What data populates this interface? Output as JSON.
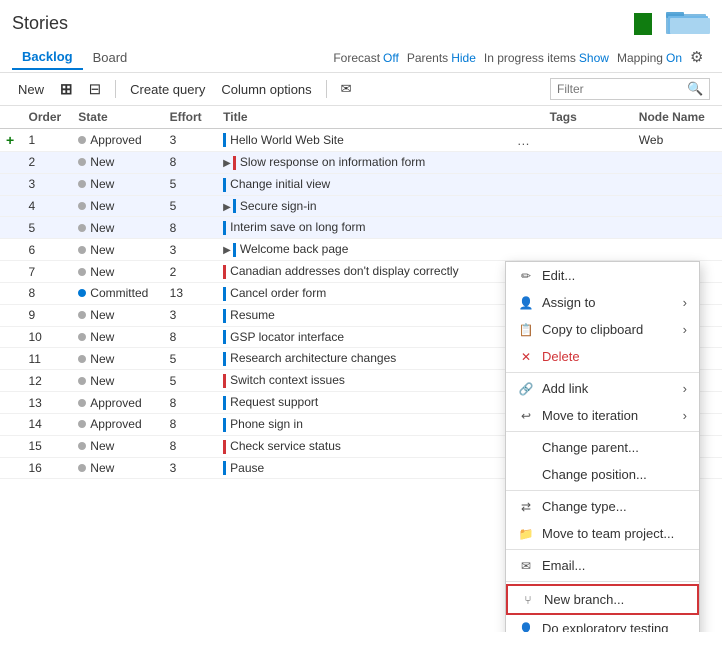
{
  "page": {
    "title": "Stories",
    "nav": {
      "backlog_label": "Backlog",
      "board_label": "Board",
      "forecast_label": "Forecast",
      "forecast_value": "Off",
      "parents_label": "Parents",
      "parents_value": "Hide",
      "inprogress_label": "In progress items",
      "inprogress_value": "Show",
      "mapping_label": "Mapping",
      "mapping_value": "On"
    },
    "toolbar": {
      "new_label": "New",
      "add_icon_label": "+",
      "expand_label": "⊟",
      "create_query_label": "Create query",
      "column_options_label": "Column options",
      "email_label": "✉",
      "filter_placeholder": "Filter"
    },
    "table": {
      "columns": [
        "",
        "Order",
        "State",
        "Effort",
        "Title",
        "",
        "Tags",
        "Node Name"
      ],
      "rows": [
        {
          "order": 1,
          "state": "Approved",
          "state_color": "grey",
          "effort": 3,
          "title": "Hello World Web Site",
          "bar_color": "blue",
          "tags": "",
          "node_name": "Web",
          "ellipsis": true
        },
        {
          "order": 2,
          "state": "New",
          "state_color": "grey",
          "effort": 8,
          "title": "Slow response on information form",
          "bar_color": "red",
          "tags": "",
          "node_name": "",
          "ellipsis": false,
          "expand": true,
          "highlighted": true
        },
        {
          "order": 3,
          "state": "New",
          "state_color": "grey",
          "effort": 5,
          "title": "Change initial view",
          "bar_color": "blue",
          "tags": "",
          "node_name": "",
          "ellipsis": false,
          "highlighted": true
        },
        {
          "order": 4,
          "state": "New",
          "state_color": "grey",
          "effort": 5,
          "title": "Secure sign-in",
          "bar_color": "blue",
          "tags": "",
          "node_name": "",
          "ellipsis": false,
          "expand": true,
          "highlighted": true
        },
        {
          "order": 5,
          "state": "New",
          "state_color": "grey",
          "effort": 8,
          "title": "Interim save on long form",
          "bar_color": "blue",
          "tags": "",
          "node_name": "",
          "ellipsis": false,
          "highlighted": true
        },
        {
          "order": 6,
          "state": "New",
          "state_color": "grey",
          "effort": 3,
          "title": "Welcome back page",
          "bar_color": "blue",
          "tags": "",
          "node_name": "",
          "ellipsis": false,
          "expand": true
        },
        {
          "order": 7,
          "state": "New",
          "state_color": "grey",
          "effort": 2,
          "title": "Canadian addresses don't display correctly",
          "bar_color": "red",
          "tags": "",
          "node_name": ""
        },
        {
          "order": 8,
          "state": "Committed",
          "state_color": "blue",
          "effort": 13,
          "title": "Cancel order form",
          "bar_color": "blue",
          "tags": "",
          "node_name": ""
        },
        {
          "order": 9,
          "state": "New",
          "state_color": "grey",
          "effort": 3,
          "title": "Resume",
          "bar_color": "blue",
          "tags": "",
          "node_name": ""
        },
        {
          "order": 10,
          "state": "New",
          "state_color": "grey",
          "effort": 8,
          "title": "GSP locator interface",
          "bar_color": "blue",
          "tags": "",
          "node_name": ""
        },
        {
          "order": 11,
          "state": "New",
          "state_color": "grey",
          "effort": 5,
          "title": "Research architecture changes",
          "bar_color": "blue",
          "tags": "",
          "node_name": ""
        },
        {
          "order": 12,
          "state": "New",
          "state_color": "grey",
          "effort": 5,
          "title": "Switch context issues",
          "bar_color": "red",
          "tags": "",
          "node_name": ""
        },
        {
          "order": 13,
          "state": "Approved",
          "state_color": "grey",
          "effort": 8,
          "title": "Request support",
          "bar_color": "blue",
          "tags": "",
          "node_name": ""
        },
        {
          "order": 14,
          "state": "Approved",
          "state_color": "grey",
          "effort": 8,
          "title": "Phone sign in",
          "bar_color": "blue",
          "tags": "",
          "node_name": ""
        },
        {
          "order": 15,
          "state": "New",
          "state_color": "grey",
          "effort": 8,
          "title": "Check service status",
          "bar_color": "red",
          "tags": "",
          "node_name": ""
        },
        {
          "order": 16,
          "state": "New",
          "state_color": "grey",
          "effort": 3,
          "title": "Pause",
          "bar_color": "blue",
          "tags": "",
          "node_name": ""
        }
      ]
    },
    "context_menu": {
      "edit": "Edit...",
      "assign_to": "Assign to",
      "copy_to_clipboard": "Copy to clipboard",
      "delete": "Delete",
      "add_link": "Add link",
      "move_to_iteration": "Move to iteration",
      "change_parent": "Change parent...",
      "change_position": "Change position...",
      "change_type": "Change type...",
      "move_to_team_project": "Move to team project...",
      "email": "Email...",
      "new_branch": "New branch...",
      "do_exploratory_testing": "Do exploratory testing"
    }
  }
}
